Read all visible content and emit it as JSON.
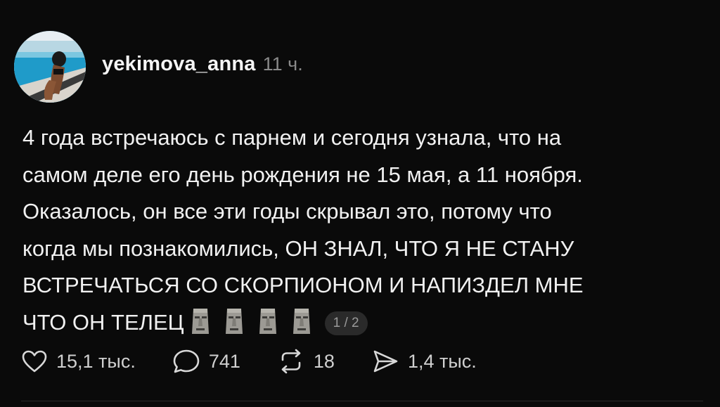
{
  "post": {
    "username": "yekimova_anna",
    "timestamp": "11 ч.",
    "text_lines": [
      "4 года встречаюсь с парнем и сегодня узнала, что на",
      "самом деле его день рождения не 15 мая, а 11 ноября.",
      "Оказалось, он все эти годы скрывал это, потому что",
      "когда мы познакомились, ОН ЗНАЛ, ЧТО Я НЕ СТАНУ",
      "ВСТРЕЧАТЬСЯ СО СКОРПИОНОМ И НАПИЗДЕЛ МНЕ",
      "ЧТО ОН ТЕЛЕЦ"
    ],
    "emoji": [
      "moai-icon",
      "moai-icon",
      "moai-icon",
      "moai-icon"
    ],
    "page_indicator": "1 / 2"
  },
  "actions": {
    "likes": "15,1 тыс.",
    "replies": "741",
    "reposts": "18",
    "shares": "1,4 тыс."
  },
  "colors": {
    "background": "#0a0a0a",
    "text": "#f1f1f1",
    "muted": "#8a8a8a"
  }
}
